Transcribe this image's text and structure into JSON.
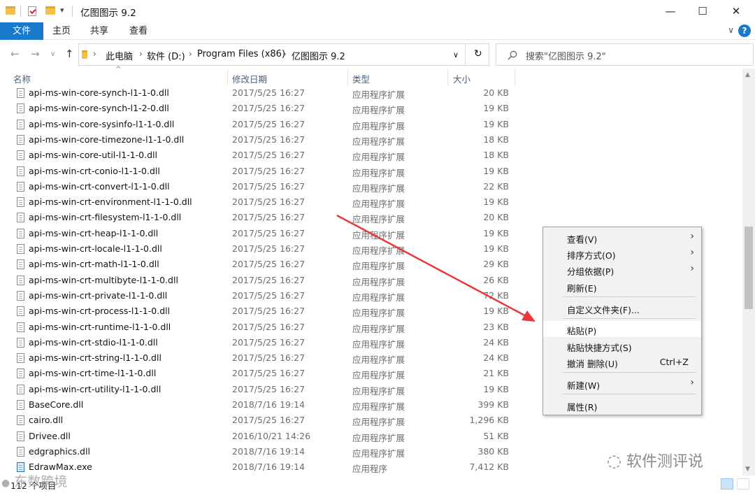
{
  "window": {
    "title": "亿图图示 9.2",
    "minimize_glyph": "—",
    "maximize_glyph": "☐",
    "close_glyph": "✕",
    "qat_dropdown": "▾"
  },
  "ribbon": {
    "tabs": [
      "文件",
      "主页",
      "共享",
      "查看"
    ],
    "collapse_glyph": "∨",
    "help_glyph": "?"
  },
  "nav": {
    "back": "←",
    "forward": "→",
    "dropdown": "∨",
    "up": "↑"
  },
  "address": {
    "crumbs": [
      "此电脑",
      "软件 (D:)",
      "Program Files (x86)",
      "亿图图示 9.2"
    ],
    "sep": "›",
    "dropdown_glyph": "∨",
    "refresh_glyph": "↻"
  },
  "search": {
    "placeholder": "搜索\"亿图图示 9.2\"",
    "icon": "search-icon"
  },
  "columns": {
    "name": "名称",
    "date": "修改日期",
    "type": "类型",
    "size": "大小",
    "sort_glyph": "^"
  },
  "files": [
    {
      "name": "api-ms-win-core-synch-l1-1-0.dll",
      "date": "2017/5/25 16:27",
      "type": "应用程序扩展",
      "size": "20 KB"
    },
    {
      "name": "api-ms-win-core-synch-l1-2-0.dll",
      "date": "2017/5/25 16:27",
      "type": "应用程序扩展",
      "size": "19 KB"
    },
    {
      "name": "api-ms-win-core-sysinfo-l1-1-0.dll",
      "date": "2017/5/25 16:27",
      "type": "应用程序扩展",
      "size": "19 KB"
    },
    {
      "name": "api-ms-win-core-timezone-l1-1-0.dll",
      "date": "2017/5/25 16:27",
      "type": "应用程序扩展",
      "size": "18 KB"
    },
    {
      "name": "api-ms-win-core-util-l1-1-0.dll",
      "date": "2017/5/25 16:27",
      "type": "应用程序扩展",
      "size": "18 KB"
    },
    {
      "name": "api-ms-win-crt-conio-l1-1-0.dll",
      "date": "2017/5/25 16:27",
      "type": "应用程序扩展",
      "size": "19 KB"
    },
    {
      "name": "api-ms-win-crt-convert-l1-1-0.dll",
      "date": "2017/5/25 16:27",
      "type": "应用程序扩展",
      "size": "22 KB"
    },
    {
      "name": "api-ms-win-crt-environment-l1-1-0.dll",
      "date": "2017/5/25 16:27",
      "type": "应用程序扩展",
      "size": "19 KB"
    },
    {
      "name": "api-ms-win-crt-filesystem-l1-1-0.dll",
      "date": "2017/5/25 16:27",
      "type": "应用程序扩展",
      "size": "20 KB"
    },
    {
      "name": "api-ms-win-crt-heap-l1-1-0.dll",
      "date": "2017/5/25 16:27",
      "type": "应用程序扩展",
      "size": "19 KB"
    },
    {
      "name": "api-ms-win-crt-locale-l1-1-0.dll",
      "date": "2017/5/25 16:27",
      "type": "应用程序扩展",
      "size": "19 KB"
    },
    {
      "name": "api-ms-win-crt-math-l1-1-0.dll",
      "date": "2017/5/25 16:27",
      "type": "应用程序扩展",
      "size": "29 KB"
    },
    {
      "name": "api-ms-win-crt-multibyte-l1-1-0.dll",
      "date": "2017/5/25 16:27",
      "type": "应用程序扩展",
      "size": "26 KB"
    },
    {
      "name": "api-ms-win-crt-private-l1-1-0.dll",
      "date": "2017/5/25 16:27",
      "type": "应用程序扩展",
      "size": "72 KB"
    },
    {
      "name": "api-ms-win-crt-process-l1-1-0.dll",
      "date": "2017/5/25 16:27",
      "type": "应用程序扩展",
      "size": "19 KB"
    },
    {
      "name": "api-ms-win-crt-runtime-l1-1-0.dll",
      "date": "2017/5/25 16:27",
      "type": "应用程序扩展",
      "size": "23 KB"
    },
    {
      "name": "api-ms-win-crt-stdio-l1-1-0.dll",
      "date": "2017/5/25 16:27",
      "type": "应用程序扩展",
      "size": "24 KB"
    },
    {
      "name": "api-ms-win-crt-string-l1-1-0.dll",
      "date": "2017/5/25 16:27",
      "type": "应用程序扩展",
      "size": "24 KB"
    },
    {
      "name": "api-ms-win-crt-time-l1-1-0.dll",
      "date": "2017/5/25 16:27",
      "type": "应用程序扩展",
      "size": "21 KB"
    },
    {
      "name": "api-ms-win-crt-utility-l1-1-0.dll",
      "date": "2017/5/25 16:27",
      "type": "应用程序扩展",
      "size": "19 KB"
    },
    {
      "name": "BaseCore.dll",
      "date": "2018/7/16 19:14",
      "type": "应用程序扩展",
      "size": "399 KB"
    },
    {
      "name": "cairo.dll",
      "date": "2017/5/25 16:27",
      "type": "应用程序扩展",
      "size": "1,296 KB"
    },
    {
      "name": "Drivee.dll",
      "date": "2016/10/21 14:26",
      "type": "应用程序扩展",
      "size": "51 KB"
    },
    {
      "name": "edgraphics.dll",
      "date": "2018/7/16 19:14",
      "type": "应用程序扩展",
      "size": "380 KB"
    },
    {
      "name": "EdrawMax.exe",
      "date": "2018/7/16 19:14",
      "type": "应用程序",
      "size": "7,412 KB"
    }
  ],
  "context_menu": {
    "view": "查看(V)",
    "sort": "排序方式(O)",
    "group": "分组依据(P)",
    "refresh": "刷新(E)",
    "customize": "自定义文件夹(F)...",
    "paste": "粘贴(P)",
    "paste_shortcut": "粘贴快捷方式(S)",
    "undo_delete": "撤消 删除(U)",
    "undo_shortcut": "Ctrl+Z",
    "new": "新建(W)",
    "properties": "属性(R)",
    "submenu_glyph": "›"
  },
  "status": {
    "text": "112 个项目"
  },
  "scroll": {
    "up_glyph": "▲",
    "down_glyph": "▼"
  },
  "watermarks": {
    "right": "软件测评说",
    "left": "东数跨境"
  },
  "colors": {
    "accent": "#1979ca",
    "arrow": "#e8383b"
  }
}
